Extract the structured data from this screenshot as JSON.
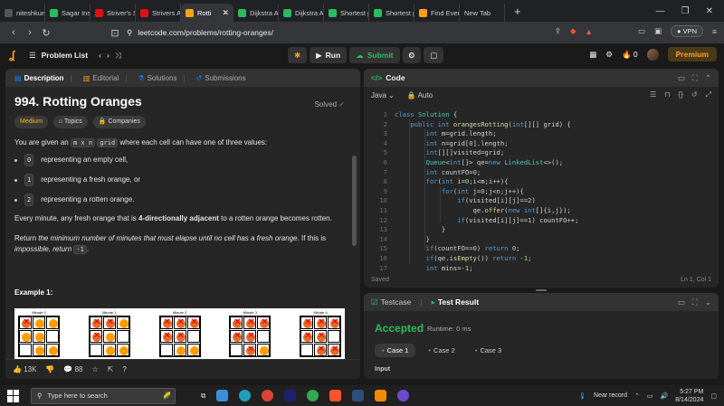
{
  "browser": {
    "tabs": [
      {
        "label": "niteshkuma",
        "color": "#555"
      },
      {
        "label": "Sagar Insta",
        "color": "#2cbb5d"
      },
      {
        "label": "Striver's S",
        "color": "#d11"
      },
      {
        "label": "Strivers A",
        "color": "#d11"
      },
      {
        "label": "Rotti",
        "color": "#ffa116",
        "active": true
      },
      {
        "label": "Dijkstra A",
        "color": "#2cbb5d"
      },
      {
        "label": "Dijkstra A",
        "color": "#2cbb5d"
      },
      {
        "label": "Shortest p",
        "color": "#2cbb5d"
      },
      {
        "label": "Shortest p",
        "color": "#2cbb5d"
      },
      {
        "label": "Find Even",
        "color": "#ffa116"
      },
      {
        "label": "New Tab",
        "color": ""
      }
    ],
    "url": "leetcode.com/problems/rotting-oranges/",
    "vpn_label": "VPN"
  },
  "lcnav": {
    "problem_list": "Problem List",
    "run": "Run",
    "submit": "Submit",
    "streak": "0",
    "premium": "Premium"
  },
  "left": {
    "tabs": [
      "Description",
      "Editorial",
      "Solutions",
      "Submissions"
    ],
    "title": "994. Rotting Oranges",
    "solved": "Solved",
    "badges": [
      "Medium",
      "Topics",
      "Companies"
    ],
    "intro_a": "You are given an ",
    "intro_code": "m x n",
    "intro_code2": "grid",
    "intro_b": " where each cell can have one of three values:",
    "bullets": [
      {
        "code": "0",
        "text": "representing an empty cell,"
      },
      {
        "code": "1",
        "text": "representing a fresh orange, or"
      },
      {
        "code": "2",
        "text": "representing a rotten orange."
      }
    ],
    "rule_a": "Every minute, any fresh orange that is ",
    "rule_bold": "4-directionally adjacent",
    "rule_b": " to a rotten orange becomes rotten.",
    "ret_a": "Return ",
    "ret_italic": "the minimum number of minutes that must elapse until no cell has a fresh orange",
    "ret_b": ". If this is ",
    "ret_italic2": "impossible, return",
    "ret_code": "-1",
    "example": "Example 1:",
    "grid_labels": [
      "Minute 0",
      "Minute 1",
      "Minute 2",
      "Minute 3",
      "Minute 4"
    ],
    "grids": [
      [
        "r",
        "f",
        "f",
        "f",
        "f",
        "e",
        "e",
        "f",
        "f"
      ],
      [
        "r",
        "r",
        "f",
        "r",
        "f",
        "e",
        "e",
        "f",
        "f"
      ],
      [
        "r",
        "r",
        "r",
        "r",
        "r",
        "e",
        "e",
        "f",
        "f"
      ],
      [
        "r",
        "r",
        "r",
        "r",
        "r",
        "e",
        "e",
        "r",
        "f"
      ],
      [
        "r",
        "r",
        "r",
        "r",
        "r",
        "e",
        "e",
        "r",
        "r"
      ]
    ],
    "likes": "13K",
    "comments": "88"
  },
  "code": {
    "title": "Code",
    "lang": "Java",
    "mode": "Auto",
    "status_left": "Saved",
    "status_right": "Ln 1, Col 1",
    "lines": [
      "class Solution {",
      "    public int orangesRotting(int[][] grid) {",
      "        int m=grid.length;",
      "        int n=grid[0].length;",
      "        int[][]visited=grid;",
      "        Queue<int[]> qe=new LinkedList<>();",
      "        int countFO=0;",
      "        for(int i=0;i<m;i++){",
      "            for(int j=0;j<n;j++){",
      "                if(visited[i][j]==2)",
      "                    qe.offer(new int[]{i,j});",
      "                if(visited[i][j]==1) countFO++;",
      "            }",
      "        }",
      "        if(countFO==0) return 0;",
      "        if(qe.isEmpty()) return -1;",
      "        int mins=-1;"
    ]
  },
  "result": {
    "tabs": [
      "Testcase",
      "Test Result"
    ],
    "status": "Accepted",
    "runtime": "Runtime: 0 ms",
    "cases": [
      "Case 1",
      "Case 2",
      "Case 3"
    ],
    "input_label": "Input"
  },
  "taskbar": {
    "search": "Type here to search",
    "weather": "Near record",
    "time": "5:27 PM",
    "date": "8/14/2024"
  }
}
